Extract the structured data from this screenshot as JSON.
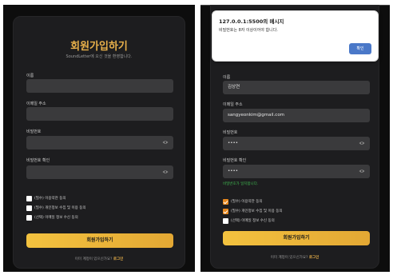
{
  "left_form": {
    "title": "회원가입하기",
    "subtitle": "SoundLetter에 오신 것을 환영합니다.",
    "name_label": "이름",
    "name_value": "",
    "email_label": "이메일 주소",
    "email_value": "",
    "password_label": "비밀번호",
    "password_value": "",
    "confirm_label": "비밀번호 확인",
    "confirm_value": "",
    "checks": [
      {
        "label": "(필수) 이용약관 동의",
        "checked": false
      },
      {
        "label": "(필수) 개인정보 수집 및 이용 동의",
        "checked": false
      },
      {
        "label": "(선택) 이메일 정보 수신 동의",
        "checked": false
      }
    ],
    "submit_label": "회원가입하기",
    "login_prompt": "이미 계정이 있으신가요?",
    "login_link": "로그인"
  },
  "right_form": {
    "name_label": "이름",
    "name_value": "김상연",
    "email_label": "이메일 주소",
    "email_value": "sangyeonkim@gmail.com",
    "password_label": "비밀번호",
    "password_value": "••••",
    "confirm_label": "비밀번호 확인",
    "confirm_value": "••••",
    "match_hint": "비밀번호가 일치합니다.",
    "checks": [
      {
        "label": "(필수) 이용약관 동의",
        "checked": true
      },
      {
        "label": "(필수) 개인정보 수집 및 이용 동의",
        "checked": true
      },
      {
        "label": "(선택) 이메일 정보 수신 동의",
        "checked": false
      }
    ],
    "submit_label": "회원가입하기",
    "login_prompt": "이미 계정이 있으신가요?",
    "login_link": "로그인"
  },
  "alert": {
    "title": "127.0.0.1:5500의 메시지",
    "message": "비밀번호는 8자 이상이어야 합니다.",
    "ok_label": "확인"
  },
  "icons": {
    "eye": "eye-icon"
  },
  "colors": {
    "accent": "#e8b04a",
    "button_gradient_start": "#f3c23f",
    "button_gradient_end": "#e3a834",
    "checkbox_on": "#e8891f",
    "success": "#3fb950",
    "alert_button": "#4a78c8"
  }
}
